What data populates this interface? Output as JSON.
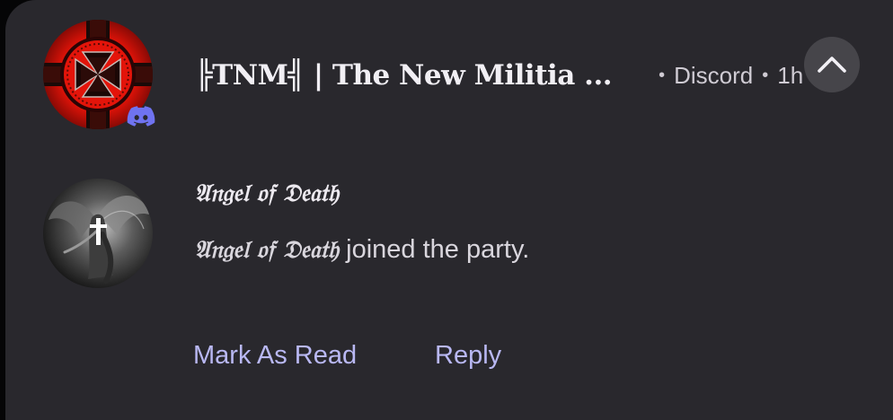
{
  "notification": {
    "server_name": "╠TNM╣ | The New Militia ...",
    "app_name": "Discord",
    "time": "1h",
    "separator": "•",
    "sender": "𝔄𝔫𝔤𝔢𝔩 𝔬𝔣 𝔇𝔢𝔞𝔱𝔥",
    "message_name": "𝔄𝔫𝔤𝔢𝔩 𝔬𝔣 𝔇𝔢𝔞𝔱𝔥",
    "message_text": " joined the party.",
    "actions": {
      "mark_read": "Mark As Read",
      "reply": "Reply"
    }
  },
  "icons": {
    "server_avatar": "iron-cross-avatar",
    "app_badge": "discord-icon",
    "collapse": "chevron-up-icon",
    "user_avatar": "angel-avatar"
  },
  "colors": {
    "background": "#29282d",
    "accent": "#b9b8f3",
    "discord": "#5865f2"
  }
}
